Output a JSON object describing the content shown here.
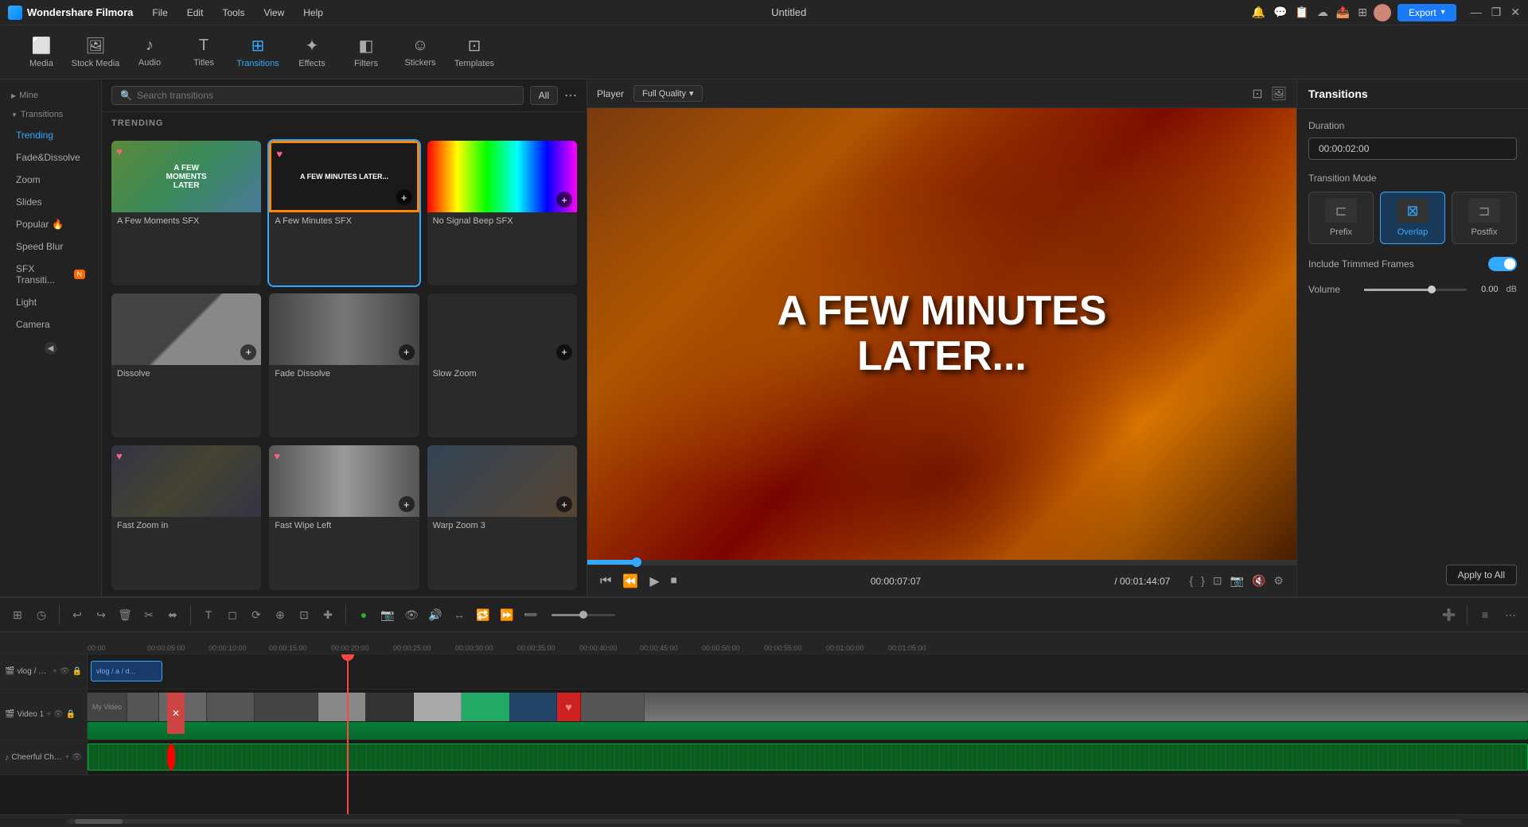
{
  "app": {
    "name": "Wondershare Filmora",
    "title": "Untitled",
    "logo_symbol": "🎬"
  },
  "topbar": {
    "menus": [
      "File",
      "Edit",
      "Tools",
      "View",
      "Help"
    ],
    "export_label": "Export",
    "win_minimize": "—",
    "win_restore": "❐",
    "win_close": "✕"
  },
  "toolbar": {
    "items": [
      {
        "id": "media",
        "icon": "⬜",
        "label": "Media"
      },
      {
        "id": "stock-media",
        "icon": "🖼",
        "label": "Stock Media"
      },
      {
        "id": "audio",
        "icon": "♪",
        "label": "Audio"
      },
      {
        "id": "titles",
        "icon": "T",
        "label": "Titles"
      },
      {
        "id": "transitions",
        "icon": "⊞",
        "label": "Transitions",
        "active": true
      },
      {
        "id": "effects",
        "icon": "✦",
        "label": "Effects"
      },
      {
        "id": "filters",
        "icon": "◧",
        "label": "Filters"
      },
      {
        "id": "stickers",
        "icon": "☺",
        "label": "Stickers"
      },
      {
        "id": "templates",
        "icon": "⊡",
        "label": "Templates"
      }
    ]
  },
  "left_panel": {
    "mine_label": "Mine",
    "transitions_label": "Transitions",
    "items": [
      {
        "id": "trending",
        "label": "Trending",
        "active": true
      },
      {
        "id": "fade-dissolve",
        "label": "Fade&Dissolve"
      },
      {
        "id": "zoom",
        "label": "Zoom"
      },
      {
        "id": "slides",
        "label": "Slides"
      },
      {
        "id": "popular",
        "label": "Popular",
        "has_flame": true
      },
      {
        "id": "speed-blur",
        "label": "Speed Blur"
      },
      {
        "id": "sfx-transition",
        "label": "SFX Transiti...",
        "has_new": true
      },
      {
        "id": "light",
        "label": "Light"
      },
      {
        "id": "camera",
        "label": "Camera"
      }
    ]
  },
  "search": {
    "placeholder": "Search transitions",
    "filter_label": "All"
  },
  "trending_label": "TRENDING",
  "transitions": [
    {
      "id": "sfx1",
      "name": "A Few Moments SFX",
      "thumb_type": "sfx1",
      "has_heart": true
    },
    {
      "id": "sfx2",
      "name": "A Few Minutes SFX",
      "thumb_type": "sfx2",
      "has_heart": true,
      "selected": true
    },
    {
      "id": "sfx3",
      "name": "No Signal Beep SFX",
      "thumb_type": "sfx3",
      "has_heart": false
    },
    {
      "id": "dissolve",
      "name": "Dissolve",
      "thumb_type": "dissolve",
      "has_heart": false
    },
    {
      "id": "fade-dissolve",
      "name": "Fade Dissolve",
      "thumb_type": "fade-dissolve",
      "has_heart": false
    },
    {
      "id": "slow-zoom",
      "name": "Slow Zoom",
      "thumb_type": "slow-zoom",
      "has_heart": false
    },
    {
      "id": "fast-zoom",
      "name": "Fast Zoom in",
      "thumb_type": "fast-zoom",
      "has_heart": true
    },
    {
      "id": "fast-wipe",
      "name": "Fast Wipe Left",
      "thumb_type": "fast-wipe",
      "has_heart": true
    },
    {
      "id": "warp-zoom",
      "name": "Warp Zoom 3",
      "thumb_type": "warp-zoom",
      "has_heart": false
    }
  ],
  "player": {
    "label": "Player",
    "quality_label": "Full Quality",
    "video_text_line1": "A Few Minutes",
    "video_text_line2": "Later...",
    "current_time": "00:00:07:07",
    "total_time": "/ 00:01:44:07",
    "progress_pct": 7
  },
  "right_panel": {
    "title": "Transitions",
    "duration_label": "Duration",
    "duration_value": "00:00:02:00",
    "transition_mode_label": "Transition Mode",
    "modes": [
      {
        "id": "prefix",
        "label": "Prefix",
        "active": false
      },
      {
        "id": "overlap",
        "label": "Overlap",
        "active": true
      },
      {
        "id": "postfix",
        "label": "Postfix",
        "active": false
      }
    ],
    "trimmed_frames_label": "Include Trimmed Frames",
    "trimmed_frames_on": true,
    "volume_label": "Volume",
    "volume_value": "0.00",
    "volume_unit": "dB",
    "apply_all_label": "Apply to All"
  },
  "bottom_toolbar": {
    "tools": [
      "⊞",
      "◷",
      "✂",
      "⬌",
      "T",
      "◻",
      "⟳",
      "⊕",
      "⊡",
      "✚"
    ]
  },
  "timeline": {
    "ruler_marks": [
      "00:00:00",
      "00:00:05:00",
      "00:00:10:00",
      "00:00:15:00",
      "00:00:20:00",
      "00:00:25:00",
      "00:00:30:00",
      "00:00:35:00",
      "00:00:40:00",
      "00:00:45:00",
      "00:00:50:00",
      "00:00:55:00",
      "00:01:00:00",
      "00:01:05:00"
    ],
    "tracks": [
      {
        "id": "overlay",
        "icon": "⬜",
        "name": "vlog / a / d...",
        "type": "overlay"
      },
      {
        "id": "video1",
        "icon": "🎬",
        "name": "Video 1",
        "type": "video"
      },
      {
        "id": "audio1",
        "icon": "♪",
        "name": "Cheerful Christmas",
        "type": "audio"
      }
    ],
    "playhead_pct": 17
  }
}
